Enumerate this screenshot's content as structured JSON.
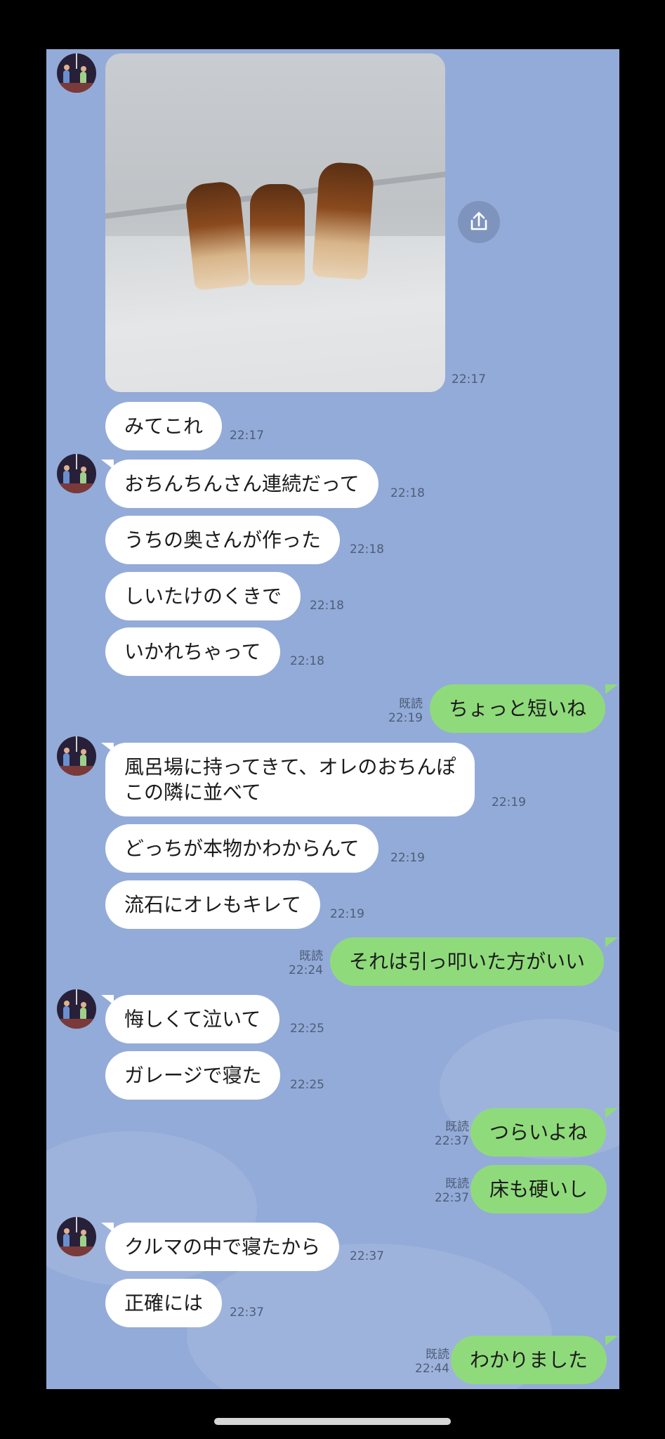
{
  "photo_message": {
    "time": "22:17",
    "image_alt": "しいたけのくき"
  },
  "messages": [
    {
      "dir": "in",
      "text": "みてこれ",
      "time": "22:17"
    },
    {
      "dir": "in",
      "text": "おちんちんさん連続だって",
      "time": "22:18"
    },
    {
      "dir": "in",
      "text": "うちの奥さんが作った",
      "time": "22:18"
    },
    {
      "dir": "in",
      "text": "しいたけのくきで",
      "time": "22:18"
    },
    {
      "dir": "in",
      "text": "いかれちゃって",
      "time": "22:18"
    },
    {
      "dir": "out",
      "text": "ちょっと短いね",
      "read": "既読",
      "time": "22:19"
    },
    {
      "dir": "in",
      "text": "風呂場に持ってきて、オレのおちんぽ",
      "text2": "この隣に並べて",
      "time": "22:19"
    },
    {
      "dir": "in",
      "text": "どっちが本物かわからんて",
      "time": "22:19"
    },
    {
      "dir": "in",
      "text": "流石にオレもキレて",
      "time": "22:19"
    },
    {
      "dir": "out",
      "text": "それは引っ叩いた方がいい",
      "read": "既読",
      "time": "22:24"
    },
    {
      "dir": "in",
      "text": "悔しくて泣いて",
      "time": "22:25"
    },
    {
      "dir": "in",
      "text": "ガレージで寝た",
      "time": "22:25"
    },
    {
      "dir": "out",
      "text": "つらいよね",
      "read": "既読",
      "time": "22:37"
    },
    {
      "dir": "out",
      "text": "床も硬いし",
      "read": "既読",
      "time": "22:37"
    },
    {
      "dir": "in",
      "text": "クルマの中で寝たから",
      "time": "22:37"
    },
    {
      "dir": "in",
      "text": "正確には",
      "time": "22:37"
    },
    {
      "dir": "out",
      "text": "わかりました",
      "read": "既読",
      "time": "22:44"
    }
  ],
  "colors": {
    "background": "#93abd8",
    "incoming": "#ffffff",
    "outgoing": "#8fdb7b"
  },
  "icons": {
    "share": "share-icon",
    "avatar": "contact-avatar"
  }
}
